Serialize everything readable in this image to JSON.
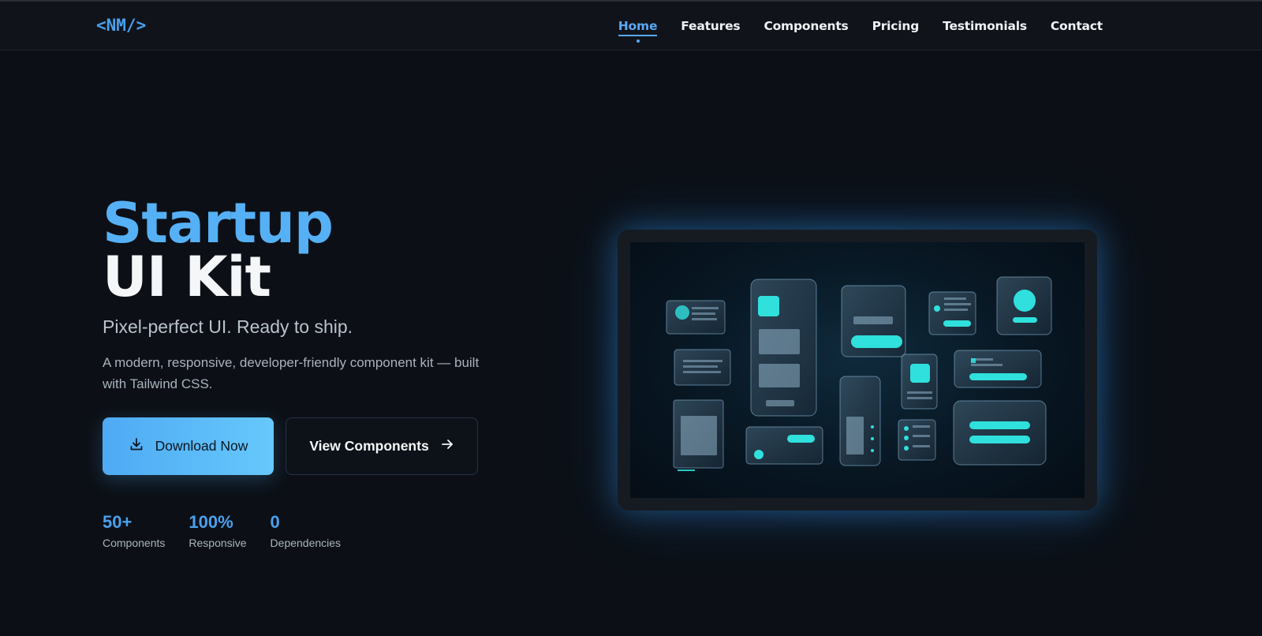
{
  "nav": {
    "logo": "<NM/>",
    "links": [
      "Home",
      "Features",
      "Components",
      "Pricing",
      "Testimonials",
      "Contact"
    ],
    "active": "Home"
  },
  "hero": {
    "title_line1": "Startup",
    "title_line2": "UI Kit",
    "subtitle": "Pixel-perfect UI. Ready to ship.",
    "description": "A modern, responsive, developer-friendly component kit — built with Tailwind CSS.",
    "primary_button": "Download Now",
    "secondary_button": "View Components",
    "stats": [
      {
        "value": "50+",
        "label": "Components"
      },
      {
        "value": "100%",
        "label": "Responsive"
      },
      {
        "value": "0",
        "label": "Dependencies"
      }
    ]
  },
  "colors": {
    "accent": "#4aa0ee",
    "background": "#0c1016",
    "cyan": "#2fe0dc"
  },
  "icons": {
    "download": "download-icon",
    "arrow": "arrow-right-icon"
  }
}
